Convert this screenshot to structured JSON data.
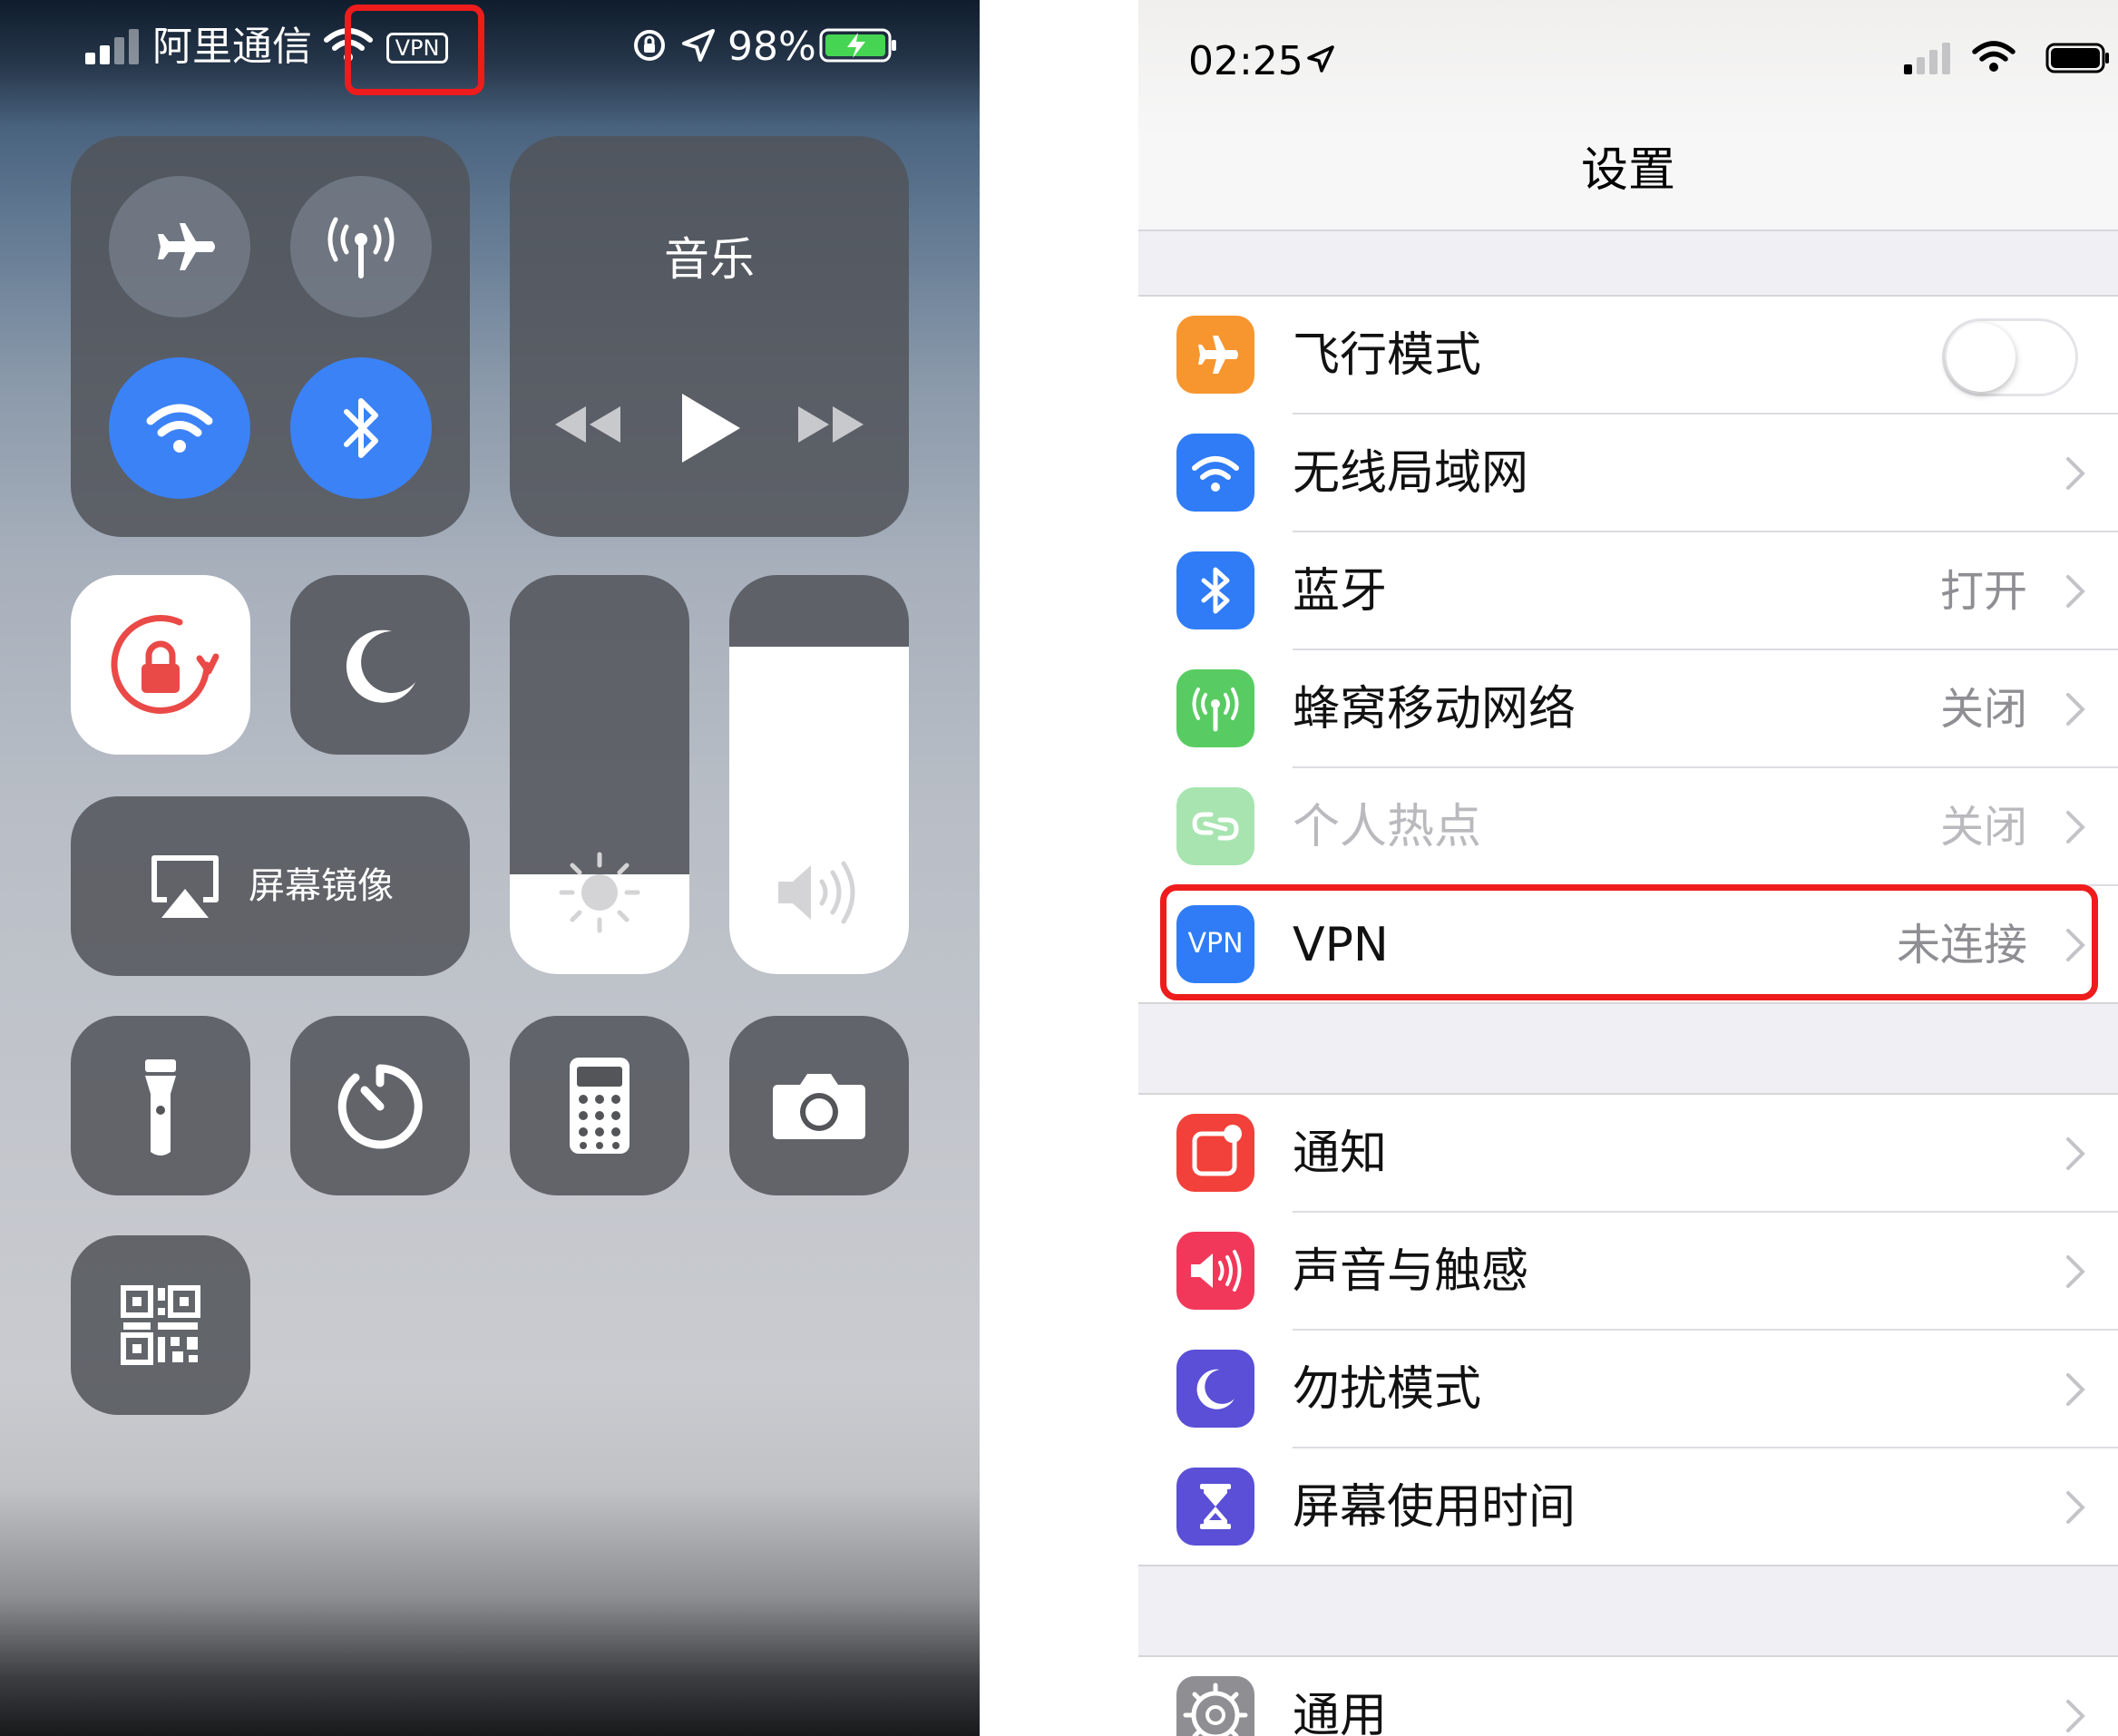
{
  "control_center": {
    "status_bar": {
      "carrier": "阿里通信",
      "vpn_badge": "VPN",
      "battery_percent": "98%"
    },
    "connectivity": {
      "airplane_mode": false,
      "cellular_data": false,
      "wifi": true,
      "bluetooth": true
    },
    "music": {
      "title": "音乐"
    },
    "screen_mirroring": {
      "label": "屏幕镜像"
    },
    "brightness_level": 0.25,
    "volume_level": 0.82,
    "colors": {
      "active_blue": "#3b82f6",
      "tile_gray": "#525459",
      "highlight_red": "#ee1c1c"
    }
  },
  "settings": {
    "status_bar": {
      "time": "02:25"
    },
    "title": "设置",
    "group1": [
      {
        "label": "飞行模式",
        "icon": "airplane-icon",
        "color": "#f7962f",
        "value": "",
        "toggle": false
      },
      {
        "label": "无线局域网",
        "icon": "wifi-icon",
        "color": "#2f7cf6",
        "value": ""
      },
      {
        "label": "蓝牙",
        "icon": "bluetooth-icon",
        "color": "#2f7cf6",
        "value": "打开"
      },
      {
        "label": "蜂窝移动网络",
        "icon": "cellular-icon",
        "color": "#58cc62",
        "value": "关闭"
      },
      {
        "label": "个人热点",
        "icon": "hotspot-icon",
        "color": "#a8e4b0",
        "value": "关闭",
        "dimmed": true
      },
      {
        "label": "VPN",
        "icon": "vpn-icon",
        "icon_text": "VPN",
        "color": "#2f7cf6",
        "value": "未连接"
      }
    ],
    "group2": [
      {
        "label": "通知",
        "icon": "notifications-icon",
        "color": "#f2403a"
      },
      {
        "label": "声音与触感",
        "icon": "sound-icon",
        "color": "#f2385a"
      },
      {
        "label": "勿扰模式",
        "icon": "moon-icon",
        "color": "#5a4fd6"
      },
      {
        "label": "屏幕使用时间",
        "icon": "hourglass-icon",
        "color": "#5a4fd6"
      }
    ],
    "group3": [
      {
        "label": "通用",
        "icon": "gear-icon",
        "color": "#8e8e93"
      }
    ]
  }
}
